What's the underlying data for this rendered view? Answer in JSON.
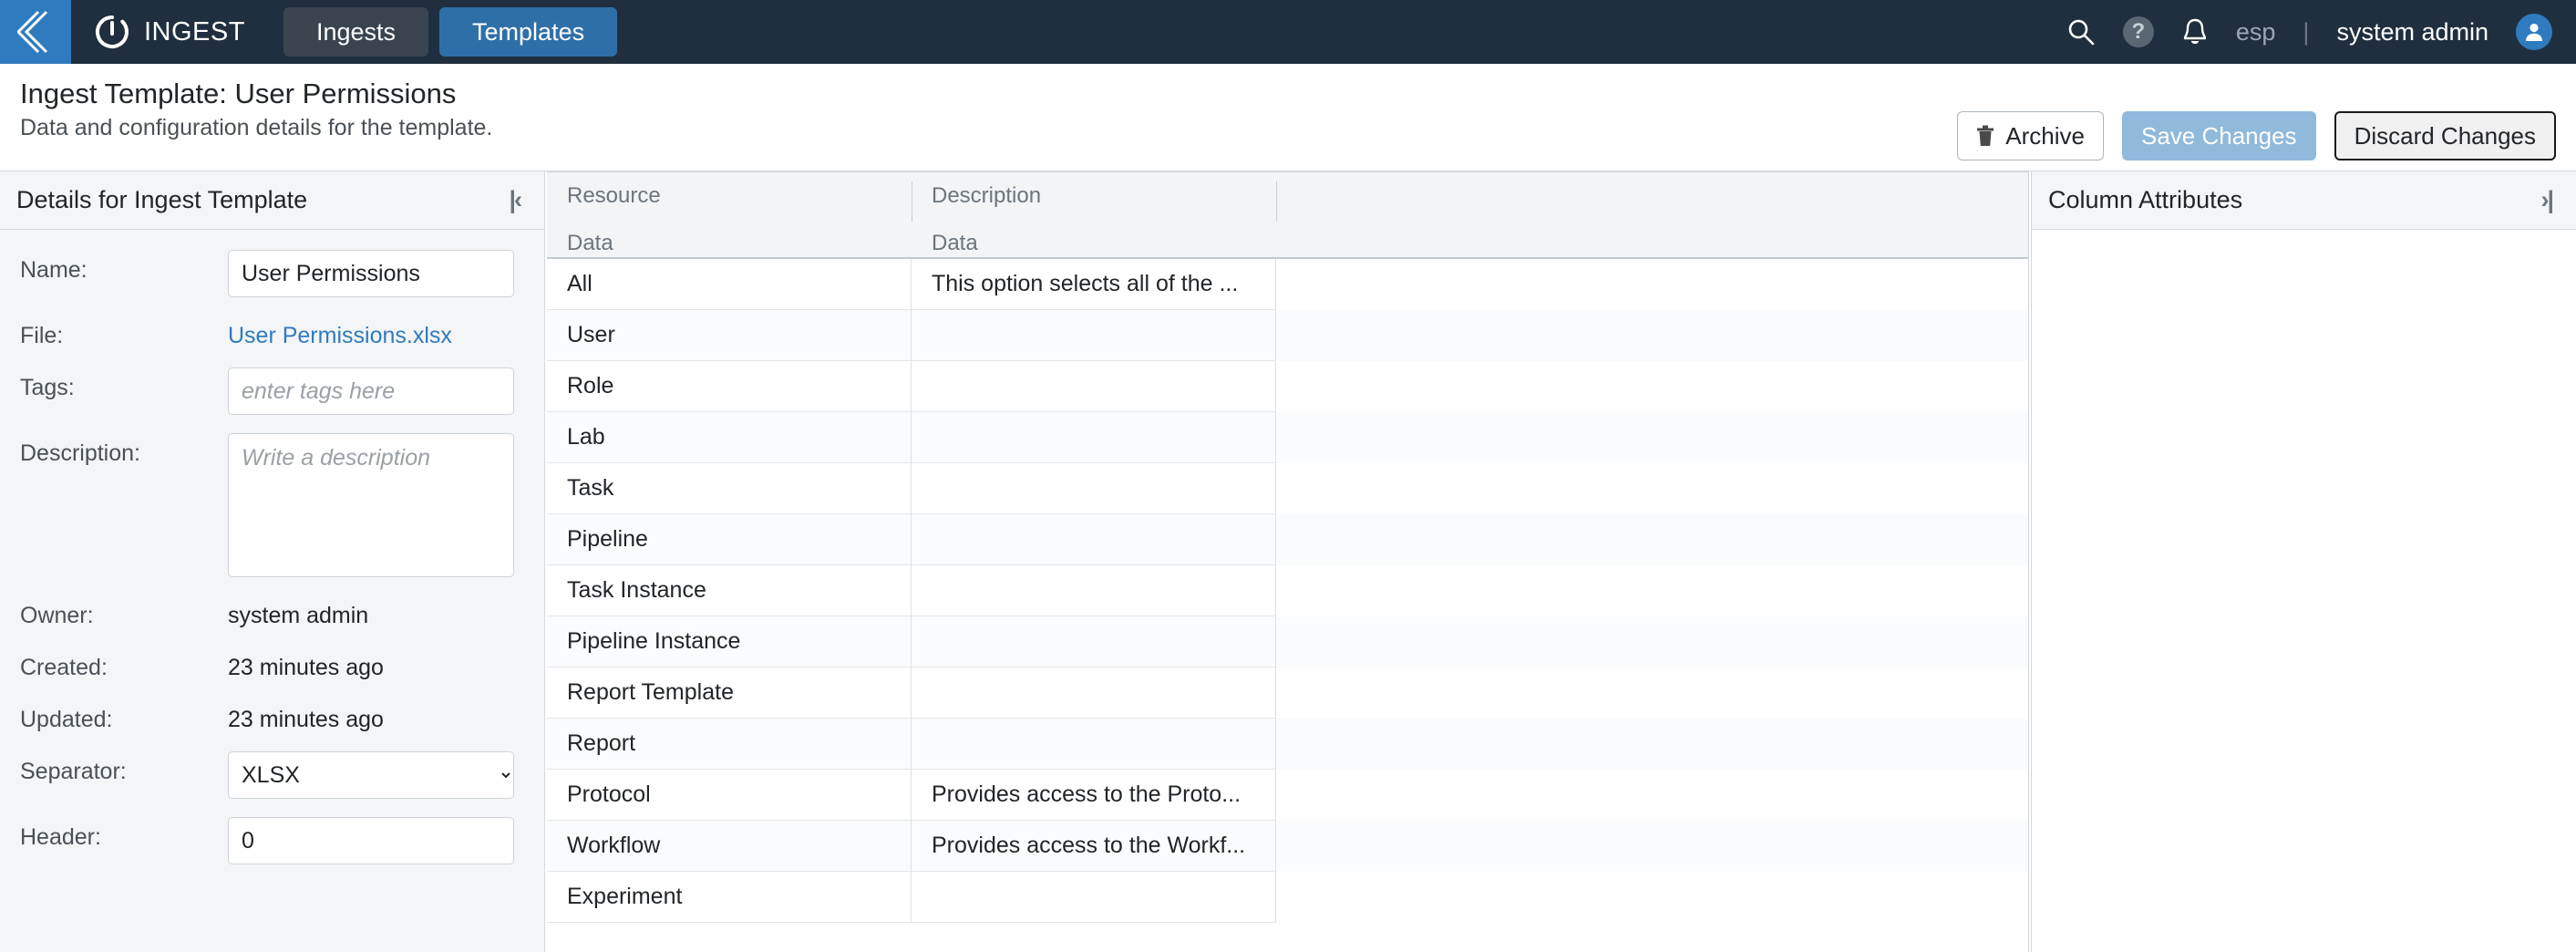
{
  "topnav": {
    "back_icon": "chevron-left-icon",
    "brand": "INGEST",
    "tabs": [
      {
        "label": "Ingests",
        "active": false
      },
      {
        "label": "Templates",
        "active": true
      }
    ],
    "search_icon": "search-icon",
    "help_icon": "help-icon",
    "help_glyph": "?",
    "notification_icon": "bell-icon",
    "language": "esp",
    "separator": "|",
    "username": "system admin",
    "avatar_icon": "user-avatar-icon",
    "accent_blue": "#2f7bbf",
    "bar_color": "#1f2f3f"
  },
  "titlebar": {
    "title": "Ingest Template: User Permissions",
    "subtitle": "Data and configuration details for the template.",
    "archive_label": "Archive",
    "archive_icon": "trash-icon",
    "save_label": "Save Changes",
    "discard_label": "Discard Changes"
  },
  "left_panel": {
    "title": "Details for Ingest Template",
    "collapse_icon": "collapse-left-icon",
    "collapse_glyph": "|‹",
    "fields": {
      "name_label": "Name:",
      "name_value": "User Permissions",
      "file_label": "File:",
      "file_value": "User Permissions.xlsx",
      "tags_label": "Tags:",
      "tags_value": "",
      "tags_placeholder": "enter tags here",
      "description_label": "Description:",
      "description_value": "",
      "description_placeholder": "Write a description",
      "owner_label": "Owner:",
      "owner_value": "system admin",
      "created_label": "Created:",
      "created_value": "23 minutes ago",
      "updated_label": "Updated:",
      "updated_value": "23 minutes ago",
      "separator_label": "Separator:",
      "separator_value": "XLSX",
      "separator_options": [
        "XLSX"
      ],
      "header_label": "Header:",
      "header_value": "0"
    }
  },
  "grid": {
    "columns": [
      {
        "header": "Resource",
        "subheader": "Data"
      },
      {
        "header": "Description",
        "subheader": "Data"
      },
      {
        "header": "",
        "subheader": ""
      }
    ],
    "rows": [
      {
        "resource": "All",
        "description": "This option selects all of the ..."
      },
      {
        "resource": "User",
        "description": ""
      },
      {
        "resource": "Role",
        "description": ""
      },
      {
        "resource": "Lab",
        "description": ""
      },
      {
        "resource": "Task",
        "description": ""
      },
      {
        "resource": "Pipeline",
        "description": ""
      },
      {
        "resource": "Task Instance",
        "description": ""
      },
      {
        "resource": "Pipeline Instance",
        "description": ""
      },
      {
        "resource": "Report Template",
        "description": ""
      },
      {
        "resource": "Report",
        "description": ""
      },
      {
        "resource": "Protocol",
        "description": "Provides access to the Proto..."
      },
      {
        "resource": "Workflow",
        "description": "Provides access to the Workf..."
      },
      {
        "resource": "Experiment",
        "description": ""
      }
    ]
  },
  "right_panel": {
    "title": "Column Attributes",
    "collapse_icon": "collapse-right-icon",
    "collapse_glyph": "›|"
  }
}
